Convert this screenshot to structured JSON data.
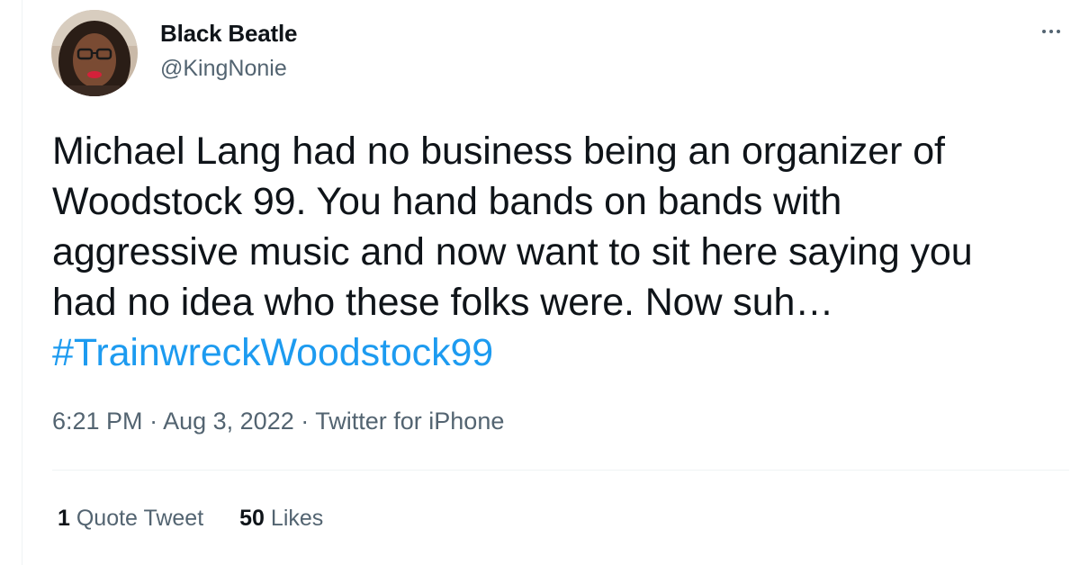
{
  "author": {
    "display_name": "Black Beatle",
    "handle": "@KingNonie"
  },
  "more_icon": "more-horizontal-icon",
  "tweet": {
    "lines": [
      "Michael Lang had no business being an organizer of",
      "Woodstock 99. You hand bands on bands with",
      "aggressive music and now want to sit here saying you",
      "had no idea who these folks were. Now suh…"
    ],
    "hashtag": "#TrainwreckWoodstock99"
  },
  "meta": {
    "time": "6:21 PM",
    "separator": "·",
    "date": "Aug 3, 2022",
    "source": "Twitter for iPhone"
  },
  "stats": {
    "quote_count": "1",
    "quote_label": "Quote Tweet",
    "like_count": "50",
    "like_label": "Likes"
  },
  "colors": {
    "text": "#0f1419",
    "secondary": "#536471",
    "accent": "#1d9bf0",
    "divider": "#eff3f4"
  }
}
